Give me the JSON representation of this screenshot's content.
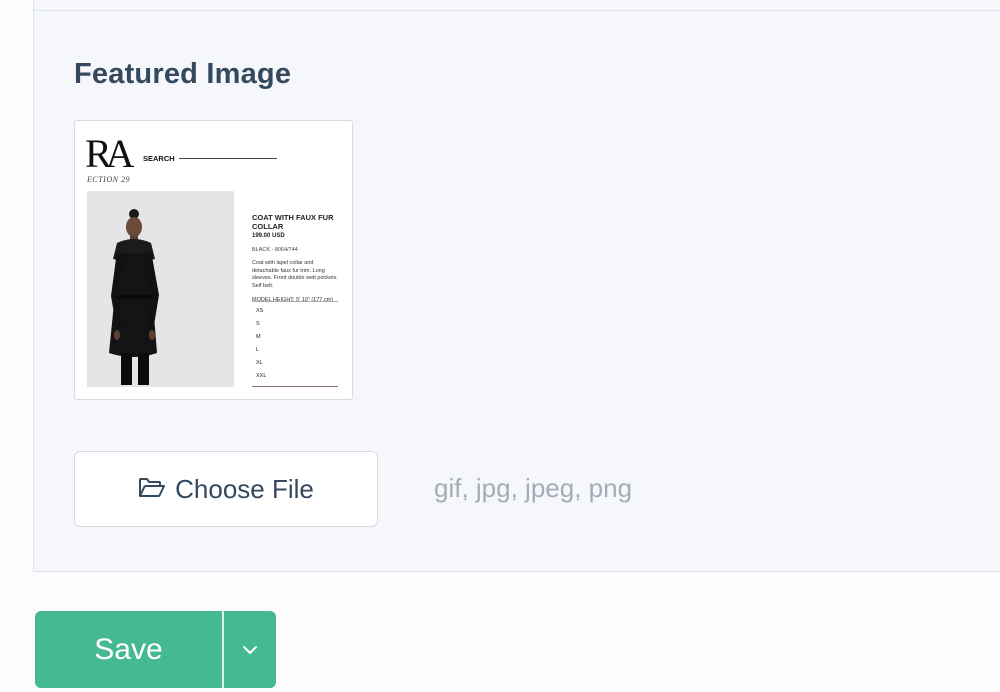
{
  "section": {
    "title": "Featured Image"
  },
  "thumbnail": {
    "logo": "RA",
    "logo_subtitle": "ECTION 29",
    "search_label": "SEARCH",
    "product": {
      "name": "COAT WITH FAUX FUR COLLAR",
      "price": "199.00 USD",
      "color": "BLACK - 8064/744",
      "description": "Coat with lapel collar and detachable faux fur trim. Long sleeves. Front double welt pockets. Self belt.",
      "model_height": "MODEL HEIGHT: 5' 10\" (177 cm)"
    },
    "sizes": [
      "XS",
      "S",
      "M",
      "L",
      "XL",
      "XXL"
    ]
  },
  "file_input": {
    "button_label": "Choose File",
    "icon": "folder-open-icon",
    "allowed_types": "gif, jpg, jpeg, png"
  },
  "actions": {
    "save_label": "Save",
    "dropdown_icon": "chevron-down-icon",
    "primary_color": "#45b993"
  }
}
